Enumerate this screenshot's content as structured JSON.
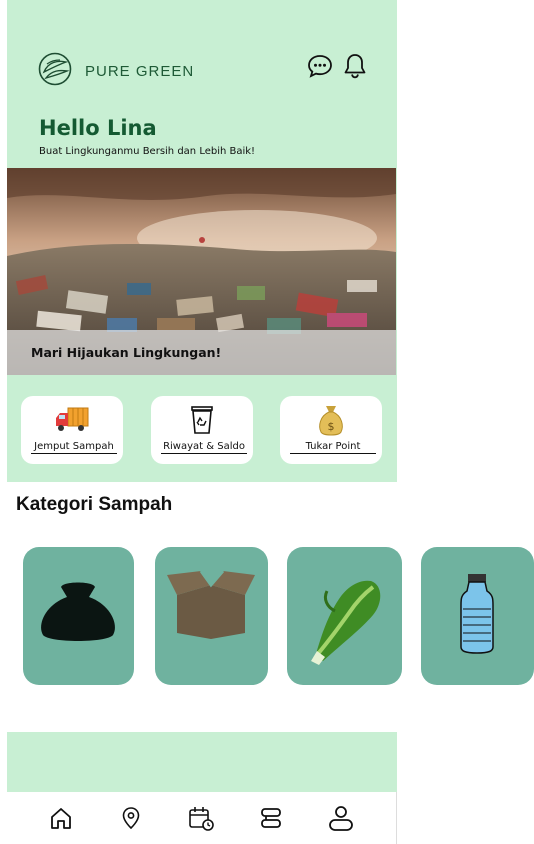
{
  "header": {
    "brand": "PURE GREEN",
    "icons": [
      "chat-icon",
      "bell-icon"
    ]
  },
  "greeting": {
    "title": "Hello Lina",
    "subtitle": "Buat Lingkunganmu Bersih dan Lebih Baik!"
  },
  "banner": {
    "caption": "Mari Hijaukan Lingkungan!"
  },
  "quick_actions": [
    {
      "label": "Jemput Sampah",
      "icon": "truck-icon"
    },
    {
      "label": "Riwayat & Saldo",
      "icon": "recycle-bin-icon"
    },
    {
      "label": "Tukar Point",
      "icon": "money-bag-icon"
    }
  ],
  "categories": {
    "title": "Kategori Sampah",
    "items": [
      {
        "icon": "trash-bag-icon"
      },
      {
        "icon": "cardboard-box-icon"
      },
      {
        "icon": "vegetable-icon"
      },
      {
        "icon": "plastic-bottle-icon"
      }
    ]
  },
  "bottom_nav": [
    "home-icon",
    "location-icon",
    "calendar-icon",
    "stack-icon",
    "profile-icon"
  ],
  "colors": {
    "mint": "#c8efd3",
    "category_tile": "#6fb29f",
    "brand_green": "#145a32"
  }
}
